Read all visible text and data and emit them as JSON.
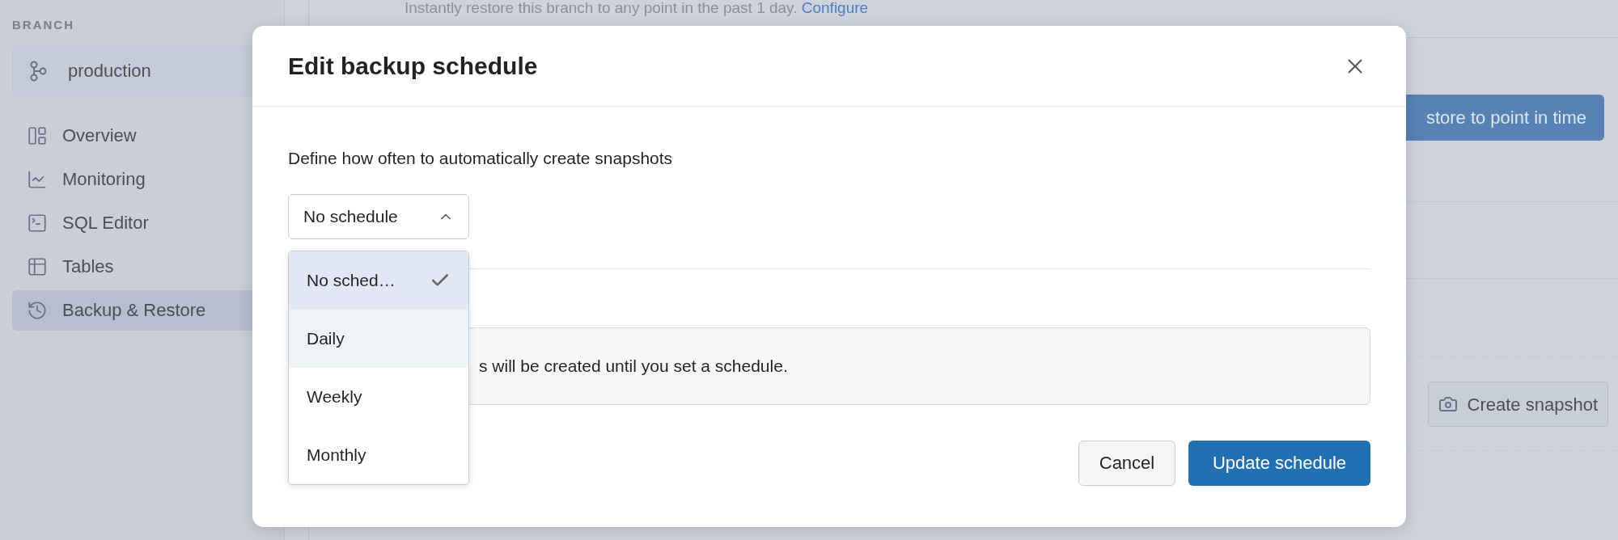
{
  "sidebar": {
    "section_label": "BRANCH",
    "branch_selector": {
      "value": "production"
    },
    "nav_items": [
      {
        "label": "Overview",
        "selected": false
      },
      {
        "label": "Monitoring",
        "selected": false
      },
      {
        "label": "SQL Editor",
        "selected": false
      },
      {
        "label": "Tables",
        "selected": false
      },
      {
        "label": "Backup & Restore",
        "selected": true
      }
    ]
  },
  "background": {
    "pitr_description": "Instantly restore this branch to any point in the past 1 day.",
    "configure_link": "Configure",
    "restore_button": "store to point in time",
    "create_snapshot_button": "Create snapshot"
  },
  "modal": {
    "title": "Edit backup schedule",
    "description": "Define how often to automatically create snapshots",
    "select": {
      "value": "No schedule",
      "expanded": true
    },
    "options": [
      {
        "label": "No sched…",
        "selected": true,
        "hovered": false
      },
      {
        "label": "Daily",
        "selected": false,
        "hovered": true
      },
      {
        "label": "Weekly",
        "selected": false,
        "hovered": false
      },
      {
        "label": "Monthly",
        "selected": false,
        "hovered": false
      }
    ],
    "info_text": "s will be created until you set a schedule.",
    "buttons": {
      "cancel": "Cancel",
      "submit": "Update schedule"
    }
  }
}
